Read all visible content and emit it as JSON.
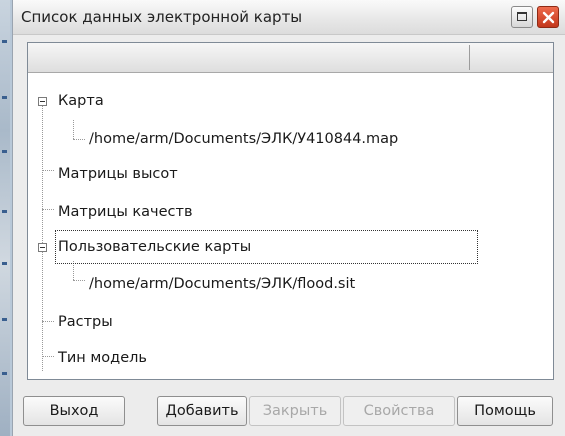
{
  "window": {
    "title": "Список данных электронной карты"
  },
  "tree": {
    "items": [
      {
        "label": "Карта",
        "expanded": true
      },
      {
        "label": "/home/arm/Documents/ЭЛК/У410844.map"
      },
      {
        "label": "Матрицы высот"
      },
      {
        "label": "Матрицы качеств"
      },
      {
        "label": "Пользовательские карты",
        "expanded": true,
        "selected": true
      },
      {
        "label": "/home/arm/Documents/ЭЛК/flood.sit"
      },
      {
        "label": "Растры"
      },
      {
        "label": "Тин модель"
      }
    ]
  },
  "buttons": {
    "exit": "Выход",
    "add": "Добавить",
    "close": "Закрыть",
    "properties": "Свойства",
    "help": "Помощь"
  },
  "colors": {
    "close_button": "#d9492c",
    "disabled_text": "#a8a8a8"
  }
}
